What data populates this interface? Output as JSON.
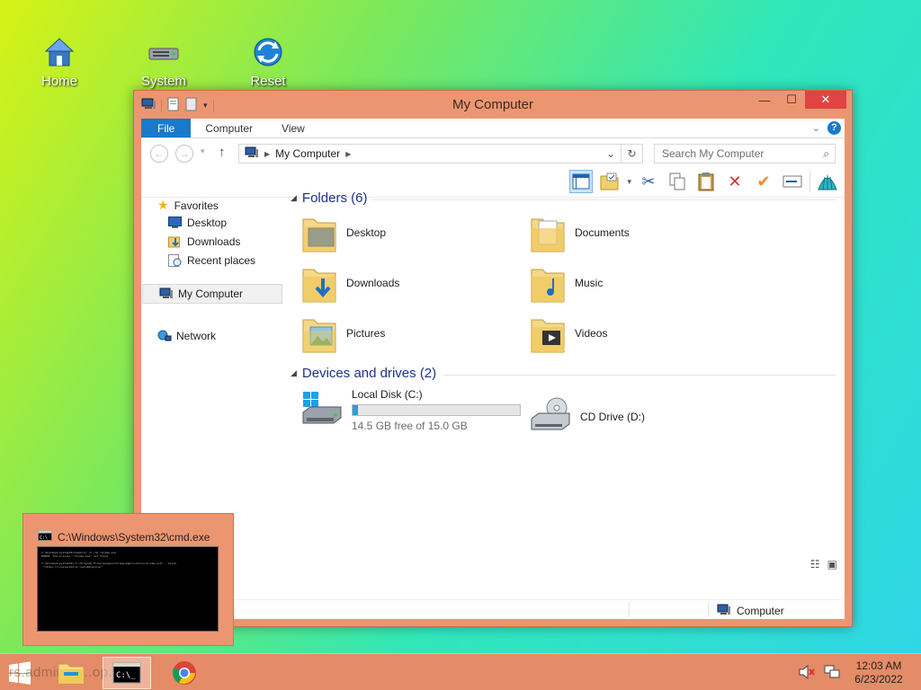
{
  "desktop": {
    "icons": [
      {
        "label": "Home"
      },
      {
        "label": "System"
      },
      {
        "label": "Reset"
      }
    ]
  },
  "window": {
    "title": "My Computer",
    "buttons": {
      "minimize": "—",
      "maximize": "☐",
      "close": "✕"
    },
    "tabs": {
      "file": "File",
      "computer": "Computer",
      "view": "View"
    },
    "address": {
      "crumb": "My Computer"
    },
    "search": {
      "placeholder": "Search My Computer"
    },
    "sidebar": {
      "favorites": "Favorites",
      "desktop": "Desktop",
      "downloads": "Downloads",
      "recent": "Recent places",
      "computer": "My Computer",
      "network": "Network"
    },
    "folders_header": "Folders (6)",
    "folders": [
      {
        "label": "Desktop"
      },
      {
        "label": "Documents"
      },
      {
        "label": "Downloads"
      },
      {
        "label": "Music"
      },
      {
        "label": "Pictures"
      },
      {
        "label": "Videos"
      }
    ],
    "devices_header": "Devices and drives (2)",
    "drives": {
      "c_label": "Local Disk (C:)",
      "c_free": "14.5 GB free of 15.0 GB",
      "c_used_fraction": 0.033,
      "d_label": "CD Drive (D:)"
    },
    "statusbar": {
      "location": "Computer"
    }
  },
  "thumbnail": {
    "title": "C:\\Windows\\System32\\cmd.exe"
  },
  "taskbar": {
    "ghost_text": "rs.adminstr...op..",
    "clock_time": "12:03 AM",
    "clock_date": "6/23/2022"
  },
  "colors": {
    "accent": "#1979ca",
    "frame": "#ec9671",
    "taskbar": "#e38c67",
    "close": "#e04343"
  }
}
